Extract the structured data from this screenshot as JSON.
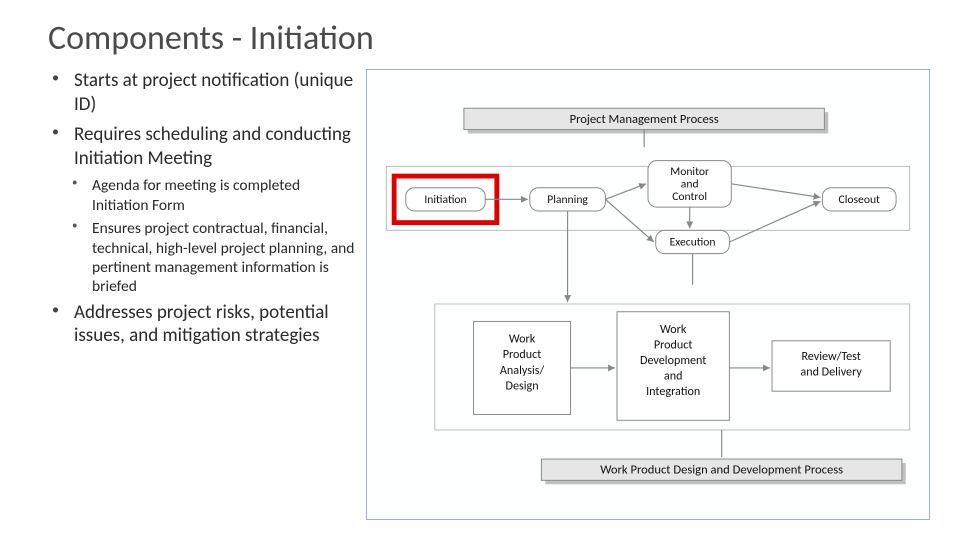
{
  "title": "Components - Initiation",
  "bullets": {
    "b1": "Starts at project notification (unique ID)",
    "b2": "Requires scheduling and conducting Initiation Meeting",
    "s1": "Agenda for meeting is completed Initiation Form",
    "s2": "Ensures project contractual, financial, technical, high-level project planning, and pertinent management information is briefed",
    "b3": "Addresses project risks, potential issues, and mitigation strategies"
  },
  "diagram": {
    "top_bar": "Project Management Process",
    "bottom_bar": "Work Product Design and Development Process",
    "phases": {
      "p1": "Initiation",
      "p2": "Planning",
      "p3_l1": "Monitor",
      "p3_l2": "and",
      "p3_l3": "Control",
      "p4": "Execution",
      "p5": "Closeout"
    },
    "wp": {
      "w1_l1": "Work",
      "w1_l2": "Product",
      "w1_l3": "Analysis/",
      "w1_l4": "Design",
      "w2_l1": "Work",
      "w2_l2": "Product",
      "w2_l3": "Development",
      "w2_l4": "and",
      "w2_l5": "Integration",
      "w3_l1": "Review/Test",
      "w3_l2": "and Delivery"
    }
  }
}
